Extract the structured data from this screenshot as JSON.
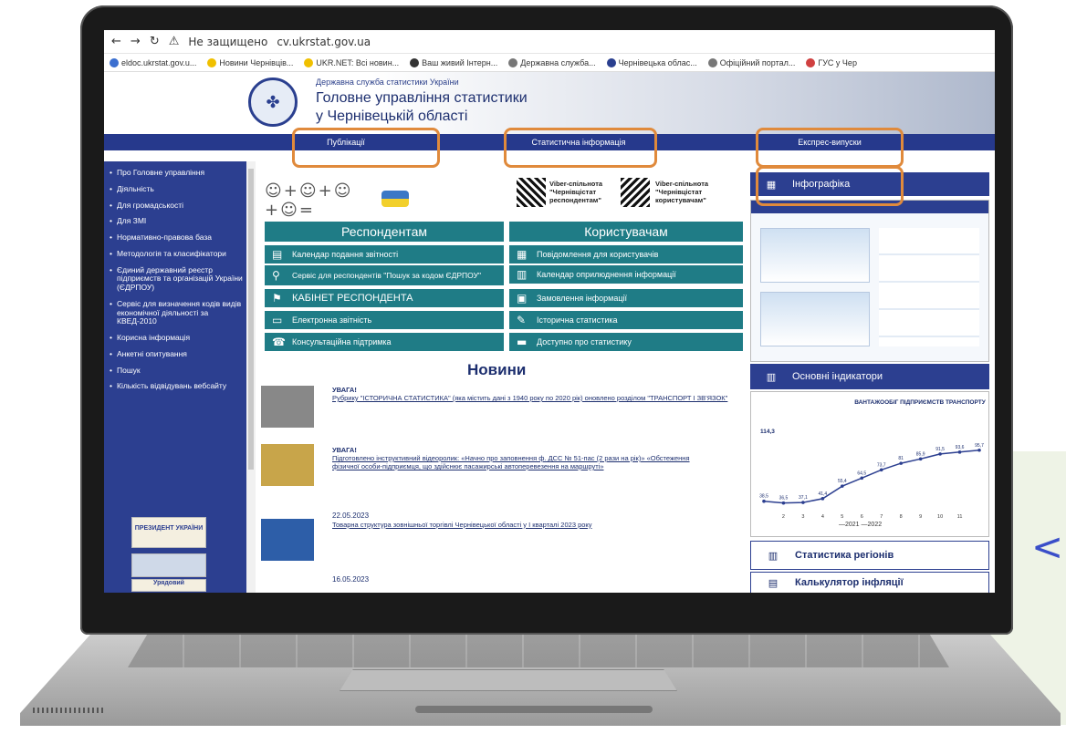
{
  "browser": {
    "url_prefix": "Не защищено",
    "url": "cv.ukrstat.gov.ua",
    "bookmarks": [
      "eldoc.ukrstat.gov.u...",
      "Новини Чернівців...",
      "UKR.NET: Всі новин...",
      "Ваш живий Інтерн...",
      "Державна служба...",
      "Чернівецька облас...",
      "Офіційний портал...",
      "ГУС у Чер"
    ]
  },
  "site": {
    "agency": "Державна служба статистики України",
    "title_line1": "Головне управління статистики",
    "title_line2": "у Чернівецькій області"
  },
  "nav": [
    "Публікації",
    "Статистична інформація",
    "Експрес-випуски"
  ],
  "sidebar": [
    "Про Головне управління",
    "Діяльність",
    "Для громадськості",
    "Для ЗМІ",
    "Нормативно-правова база",
    "Методологія та класифікатори",
    "Єдиний державний реєстр підприємств та організацій України (ЄДРПОУ)",
    "Сервіс для визначення кодів видів економічної діяльності за КВЕД-2010",
    "Корисна інформація",
    "Анкетні опитування",
    "Пошук",
    "Кількість відвідувань вебсайту"
  ],
  "sidebar_banners": [
    "ПРЕЗИДЕНТ УКРАЇНИ",
    "Урядовий"
  ],
  "viber": [
    "Viber-спільнота \"Чернівцістат респондентам\"",
    "Viber-спільнота \"Чернівцістат користувачам\""
  ],
  "respondents": {
    "header": "Респондентам",
    "items": [
      "Календар подання звітності",
      "Сервіс для респондентів \"Пошук за кодом ЄДРПОУ\"",
      "КАБІНЕТ РЕСПОНДЕНТА",
      "Електронна звітність",
      "Консультаційна підтримка"
    ]
  },
  "users": {
    "header": "Користувачам",
    "items": [
      "Повідомлення для користувачів",
      "Календар оприлюднення інформації",
      "Замовлення інформації",
      "Історична статистика",
      "Доступно про статистику"
    ]
  },
  "news": {
    "title": "Новини",
    "items": [
      {
        "head": "УВАГА!",
        "text": "Рубрику \"ІСТОРИЧНА СТАТИСТИКА\" (яка містить дані з 1940 року по 2020 рік) оновлено розділом \"ТРАНСПОРТ І ЗВ'ЯЗОК\""
      },
      {
        "head": "УВАГА!",
        "text": "Підготовлено інструктивний відеоролик: «Начно про заповнення ф. ДСС № 51-пас (2 рази на рік)» «Обстеження фізичної особи-підприємця, що здійснює пасажирські автоперевезення на маршруті»"
      },
      {
        "head": "22.05.2023",
        "text": "Товарна структура зовнішньої торгівлі Чернівецької області у I кварталі 2023 року"
      },
      {
        "head": "16.05.2023",
        "text": ""
      }
    ]
  },
  "right": {
    "infographic": "Інфографіка",
    "indicators": "Основні індикатори",
    "regions": "Статистика регіонів",
    "calc": "Калькулятор інфляції"
  },
  "chart_data": {
    "type": "line",
    "title": "ВАНТАЖООБІГ ПІДПРИЄМСТВ ТРАНСПОРТУ",
    "categories": [
      "2",
      "3",
      "4",
      "5",
      "6",
      "7",
      "8",
      "9",
      "10",
      "11"
    ],
    "series": [
      {
        "name": "2022",
        "values": [
          38.5,
          36.5,
          37.1,
          41.4,
          55.4,
          64.5,
          73.7,
          81.0,
          85.9,
          91.5,
          93.6,
          95.7
        ]
      }
    ],
    "legend": [
      "2021",
      "2022"
    ],
    "annotation": "114,3"
  },
  "colors": {
    "nav": "#26398c",
    "teal": "#1f7c86",
    "accent": "#e08a3c"
  }
}
